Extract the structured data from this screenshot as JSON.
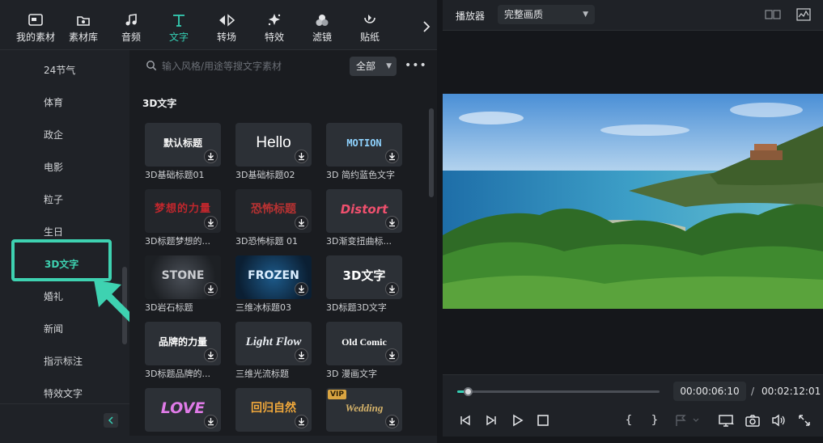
{
  "toolbar": {
    "items": [
      {
        "label": "我的素材",
        "icon": "my-media-icon"
      },
      {
        "label": "素材库",
        "icon": "stock-media-icon"
      },
      {
        "label": "音频",
        "icon": "music-note-icon"
      },
      {
        "label": "文字",
        "icon": "text-t-icon",
        "active": true
      },
      {
        "label": "转场",
        "icon": "transition-icon"
      },
      {
        "label": "特效",
        "icon": "effects-sparkle-icon"
      },
      {
        "label": "滤镜",
        "icon": "filters-icon"
      },
      {
        "label": "贴纸",
        "icon": "sticker-icon"
      }
    ],
    "more": "›"
  },
  "categories": [
    "24节气",
    "体育",
    "政企",
    "电影",
    "粒子",
    "生日",
    "3D文字",
    "婚礼",
    "新闻",
    "指示标注",
    "特效文字"
  ],
  "selected_category": "3D文字",
  "search": {
    "placeholder": "输入风格/用途等搜文字素材"
  },
  "filter": {
    "value": "全部"
  },
  "section_title": "3D文字",
  "templates": [
    {
      "name": "3D基础标题01",
      "preview": "默认标题"
    },
    {
      "name": "3D基础标题02",
      "preview": "Hello"
    },
    {
      "name": "3D 简约蓝色文字",
      "preview": "MOTION"
    },
    {
      "name": "3D标题梦想的...",
      "preview": "梦想的力量"
    },
    {
      "name": "3D恐怖标题 01",
      "preview": "恐怖标题"
    },
    {
      "name": "3D渐变扭曲标...",
      "preview": "Distort"
    },
    {
      "name": "3D岩石标题",
      "preview": "STONE"
    },
    {
      "name": "三维冰标题03",
      "preview": "FROZEN"
    },
    {
      "name": "3D标题3D文字",
      "preview": "3D文字"
    },
    {
      "name": "3D标题品牌的...",
      "preview": "品牌的力量"
    },
    {
      "name": "三维光流标题",
      "preview": "Light Flow"
    },
    {
      "name": "3D 漫画文字",
      "preview": "Old Comic"
    },
    {
      "name": "",
      "preview": "LOVE"
    },
    {
      "name": "",
      "preview": "回归自然"
    },
    {
      "name": "",
      "preview": "Wedding",
      "badge": "VIP"
    }
  ],
  "player": {
    "title": "播放器",
    "quality": "完整画质",
    "current_time": "00:00:06:10",
    "separator": "/",
    "total_time": "00:02:12:01",
    "progress": 0.05
  },
  "controls": {
    "mark_in": "{",
    "mark_out": "}"
  },
  "colors": {
    "accent": "#35d0b5",
    "annotation": "#3ed2b1",
    "vip": "#d9a441"
  }
}
